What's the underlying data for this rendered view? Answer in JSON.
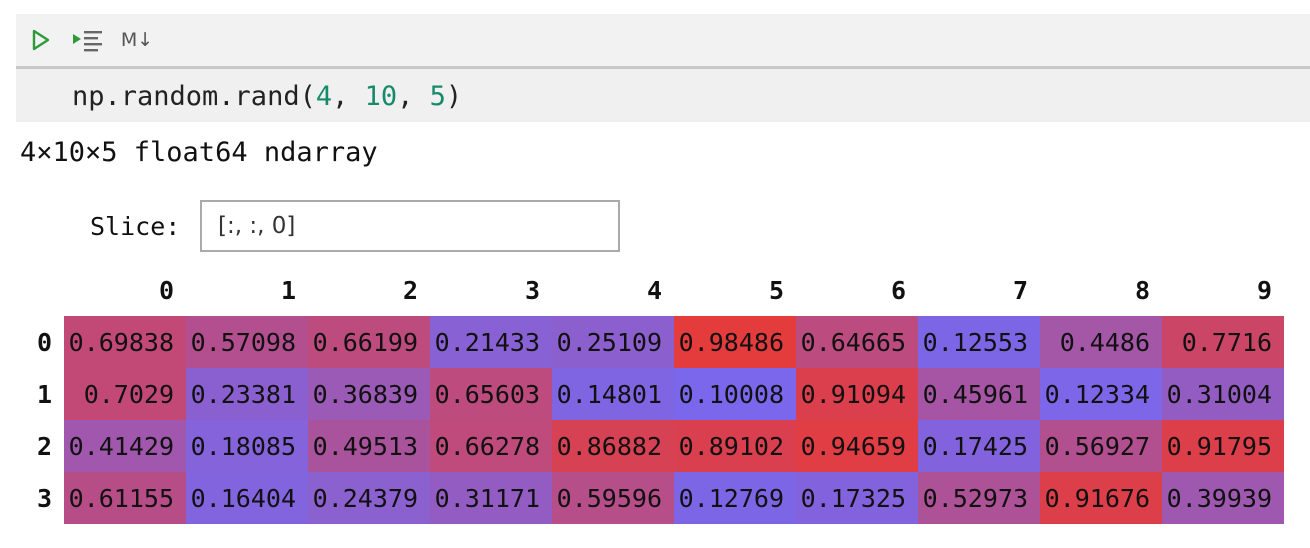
{
  "toolbar": {
    "run_icon": "play-icon",
    "run_all_icon": "run-all-icon",
    "markdown_label": "M↓"
  },
  "cell": {
    "code_prefix": "np.random.rand(",
    "arg1": "4",
    "sep1": ", ",
    "arg2": "10",
    "sep2": ", ",
    "arg3": "5",
    "code_suffix": ")"
  },
  "output": {
    "summary": "4×10×5 float64 ndarray",
    "slice_label": "Slice:",
    "slice_value": "[:, :, 0]",
    "columns": [
      "0",
      "1",
      "2",
      "3",
      "4",
      "5",
      "6",
      "7",
      "8",
      "9"
    ],
    "rows": [
      {
        "index": "0",
        "values": [
          "0.69838",
          "0.57098",
          "0.66199",
          "0.21433",
          "0.25109",
          "0.98486",
          "0.64665",
          "0.12553",
          "0.4486",
          "0.7716"
        ]
      },
      {
        "index": "1",
        "values": [
          "0.7029",
          "0.23381",
          "0.36839",
          "0.65603",
          "0.14801",
          "0.10008",
          "0.91094",
          "0.45961",
          "0.12334",
          "0.31004"
        ]
      },
      {
        "index": "2",
        "values": [
          "0.41429",
          "0.18085",
          "0.49513",
          "0.66278",
          "0.86882",
          "0.89102",
          "0.94659",
          "0.17425",
          "0.56927",
          "0.91795"
        ]
      },
      {
        "index": "3",
        "values": [
          "0.61155",
          "0.16404",
          "0.24379",
          "0.31171",
          "0.59596",
          "0.12769",
          "0.17325",
          "0.52973",
          "0.91676",
          "0.39939"
        ]
      }
    ],
    "colormap": {
      "low": "#6e6cff",
      "high": "#e63a3a"
    }
  }
}
